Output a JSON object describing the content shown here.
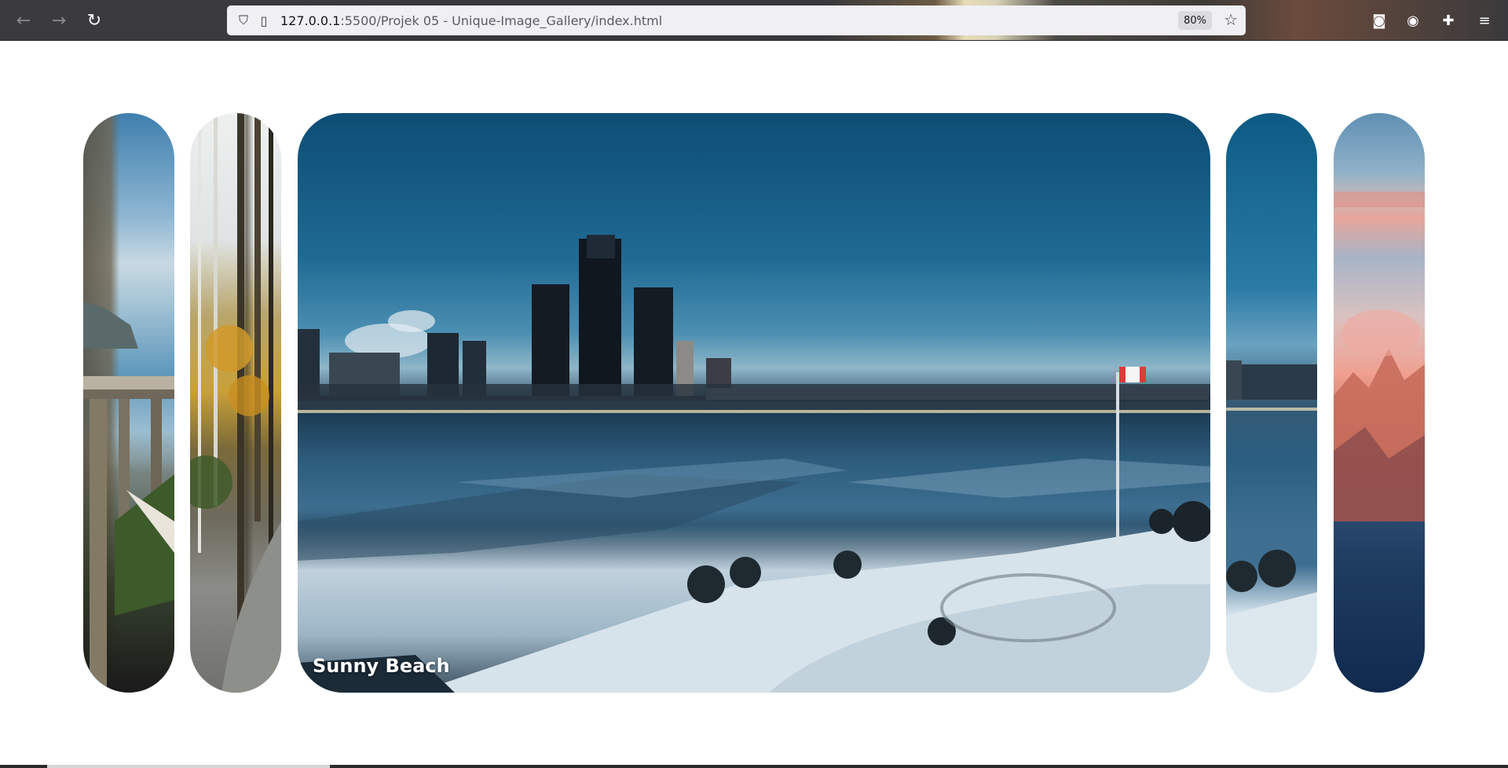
{
  "browser": {
    "back_icon": "arrow-left-icon",
    "forward_icon": "arrow-right-icon",
    "reload_icon": "reload-icon",
    "url_host": "127.0.0.1",
    "url_rest": ":5500/Projek 05 - Unique-Image_Gallery/index.html",
    "zoom": "80%"
  },
  "gallery": {
    "cards": [
      {
        "name": "card-coast-bridge",
        "caption": ""
      },
      {
        "name": "card-forest-path",
        "caption": ""
      },
      {
        "name": "card-city-river",
        "caption": "Sunny Beach"
      },
      {
        "name": "card-city-river-slice",
        "caption": ""
      },
      {
        "name": "card-mountain-sunset",
        "caption": ""
      }
    ],
    "active_index": 2
  }
}
